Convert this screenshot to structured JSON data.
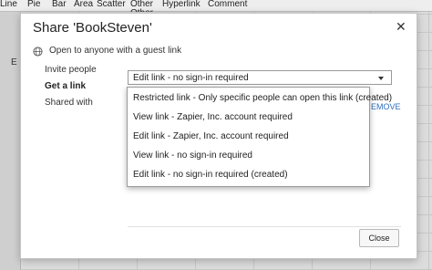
{
  "ribbon": [
    "Line",
    "Pie",
    "Bar",
    "Area",
    "Scatter",
    "Other",
    "Hyperlink",
    "Comment"
  ],
  "ribbon_other_line2": "Other",
  "background_cell_text": "E",
  "dialog": {
    "title": "Share 'BookSteven'",
    "guest_text": "Open to anyone with a guest link",
    "nav": [
      "Invite people",
      "Get a link",
      "Shared with"
    ],
    "active_nav": "Get a link",
    "select_value": "Edit link - no sign-in required",
    "remove_label": "EMOVE",
    "close_label": "Close"
  },
  "menu_options": [
    "Restricted link - Only specific people can open this link (created)",
    "View link - Zapier, Inc. account required",
    "Edit link - Zapier, Inc. account required",
    "View link - no sign-in required",
    "Edit link - no sign-in required (created)"
  ],
  "icons": {
    "globe": "globe-icon",
    "close": "close-icon",
    "caret": "chevron-down-icon"
  },
  "colors": {
    "link": "#2f6fbf",
    "dialog_bg": "#ffffff",
    "backdrop": "#d9d9d9"
  }
}
